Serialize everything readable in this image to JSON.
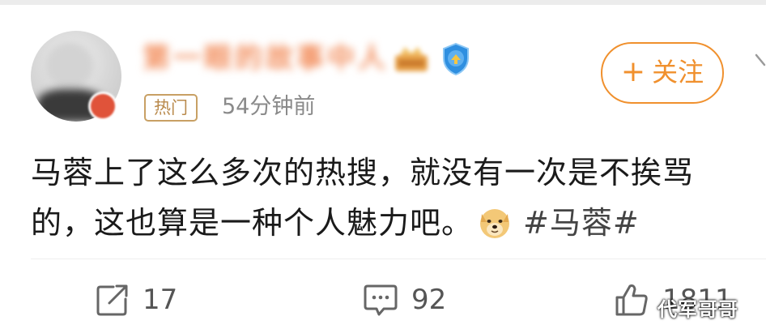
{
  "post": {
    "username": "第一眼的故事中人",
    "hot_tag": "热门",
    "time": "54分钟前",
    "follow_label": "关注",
    "text_line1": "马蓉上了这么多次的热搜，就没有一次是不挨骂",
    "text_line2": "的，这也算是一种个人魅力吧。",
    "hashtag": "#马蓉#"
  },
  "actions": {
    "repost_count": "17",
    "comment_count": "92",
    "like_count": "1811"
  },
  "watermark": "代军哥哥",
  "colors": {
    "accent": "#f0902d",
    "hot_tag": "#b98a4c",
    "verified_blue": "#2f8fe0",
    "text": "#1a1a1a",
    "muted": "#8a8a8a"
  },
  "icons": [
    "vip-crown-icon",
    "verified-badge-icon",
    "doge-emoji-icon",
    "repost-icon",
    "comment-icon",
    "like-icon"
  ]
}
